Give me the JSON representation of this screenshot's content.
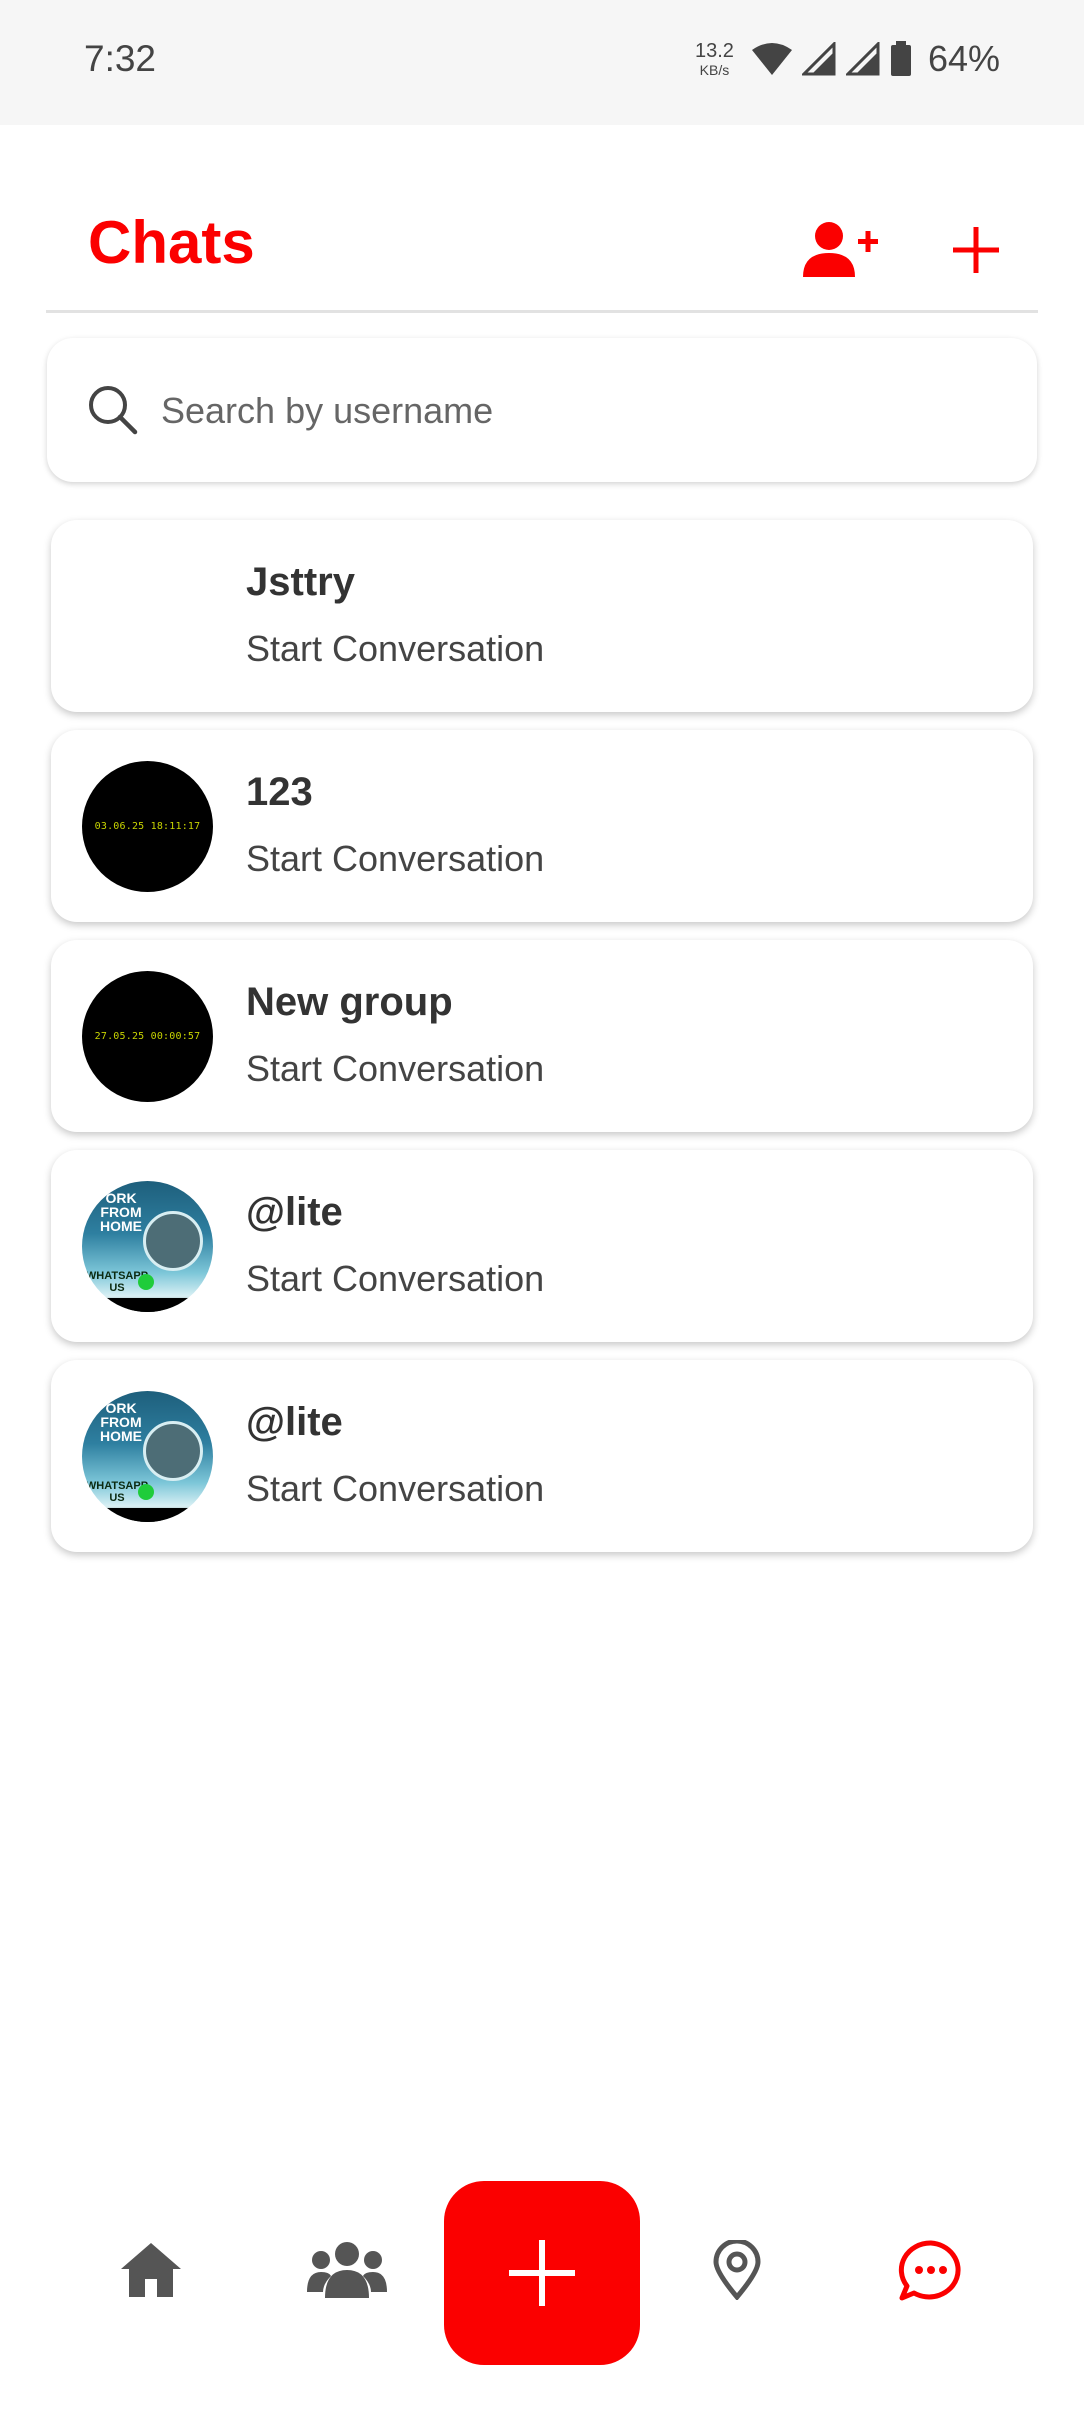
{
  "status_bar": {
    "time": "7:32",
    "net_speed_value": "13.2",
    "net_speed_unit": "KB/s",
    "battery_percent": "64%"
  },
  "header": {
    "title": "Chats",
    "add_user_icon": "user-plus-icon",
    "new_icon": "plus-icon"
  },
  "search": {
    "placeholder": "Search by username",
    "icon": "search-icon"
  },
  "chats": [
    {
      "name": "Jsttry",
      "subtitle": "Start Conversation",
      "avatar": "none"
    },
    {
      "name": "123",
      "subtitle": "Start Conversation",
      "avatar": "black",
      "avatar_text": "03.06.25 18:11:17"
    },
    {
      "name": "New group",
      "subtitle": "Start Conversation",
      "avatar": "black",
      "avatar_text": "27.05.25 00:00:57"
    },
    {
      "name": "@lite",
      "subtitle": "Start Conversation",
      "avatar": "poster",
      "avatar_text": "ORK FROM HOME",
      "avatar_footer": "WHATSAPP US"
    },
    {
      "name": "@lite",
      "subtitle": "Start Conversation",
      "avatar": "poster",
      "avatar_text": "ORK FROM HOME",
      "avatar_footer": "WHATSAPP US"
    }
  ],
  "bottom_nav": {
    "items": [
      "home-icon",
      "people-icon",
      "add-fab",
      "location-icon",
      "chat-icon"
    ],
    "active": "chat-icon"
  },
  "colors": {
    "accent": "#fb0000",
    "icon_gray": "#555555"
  }
}
